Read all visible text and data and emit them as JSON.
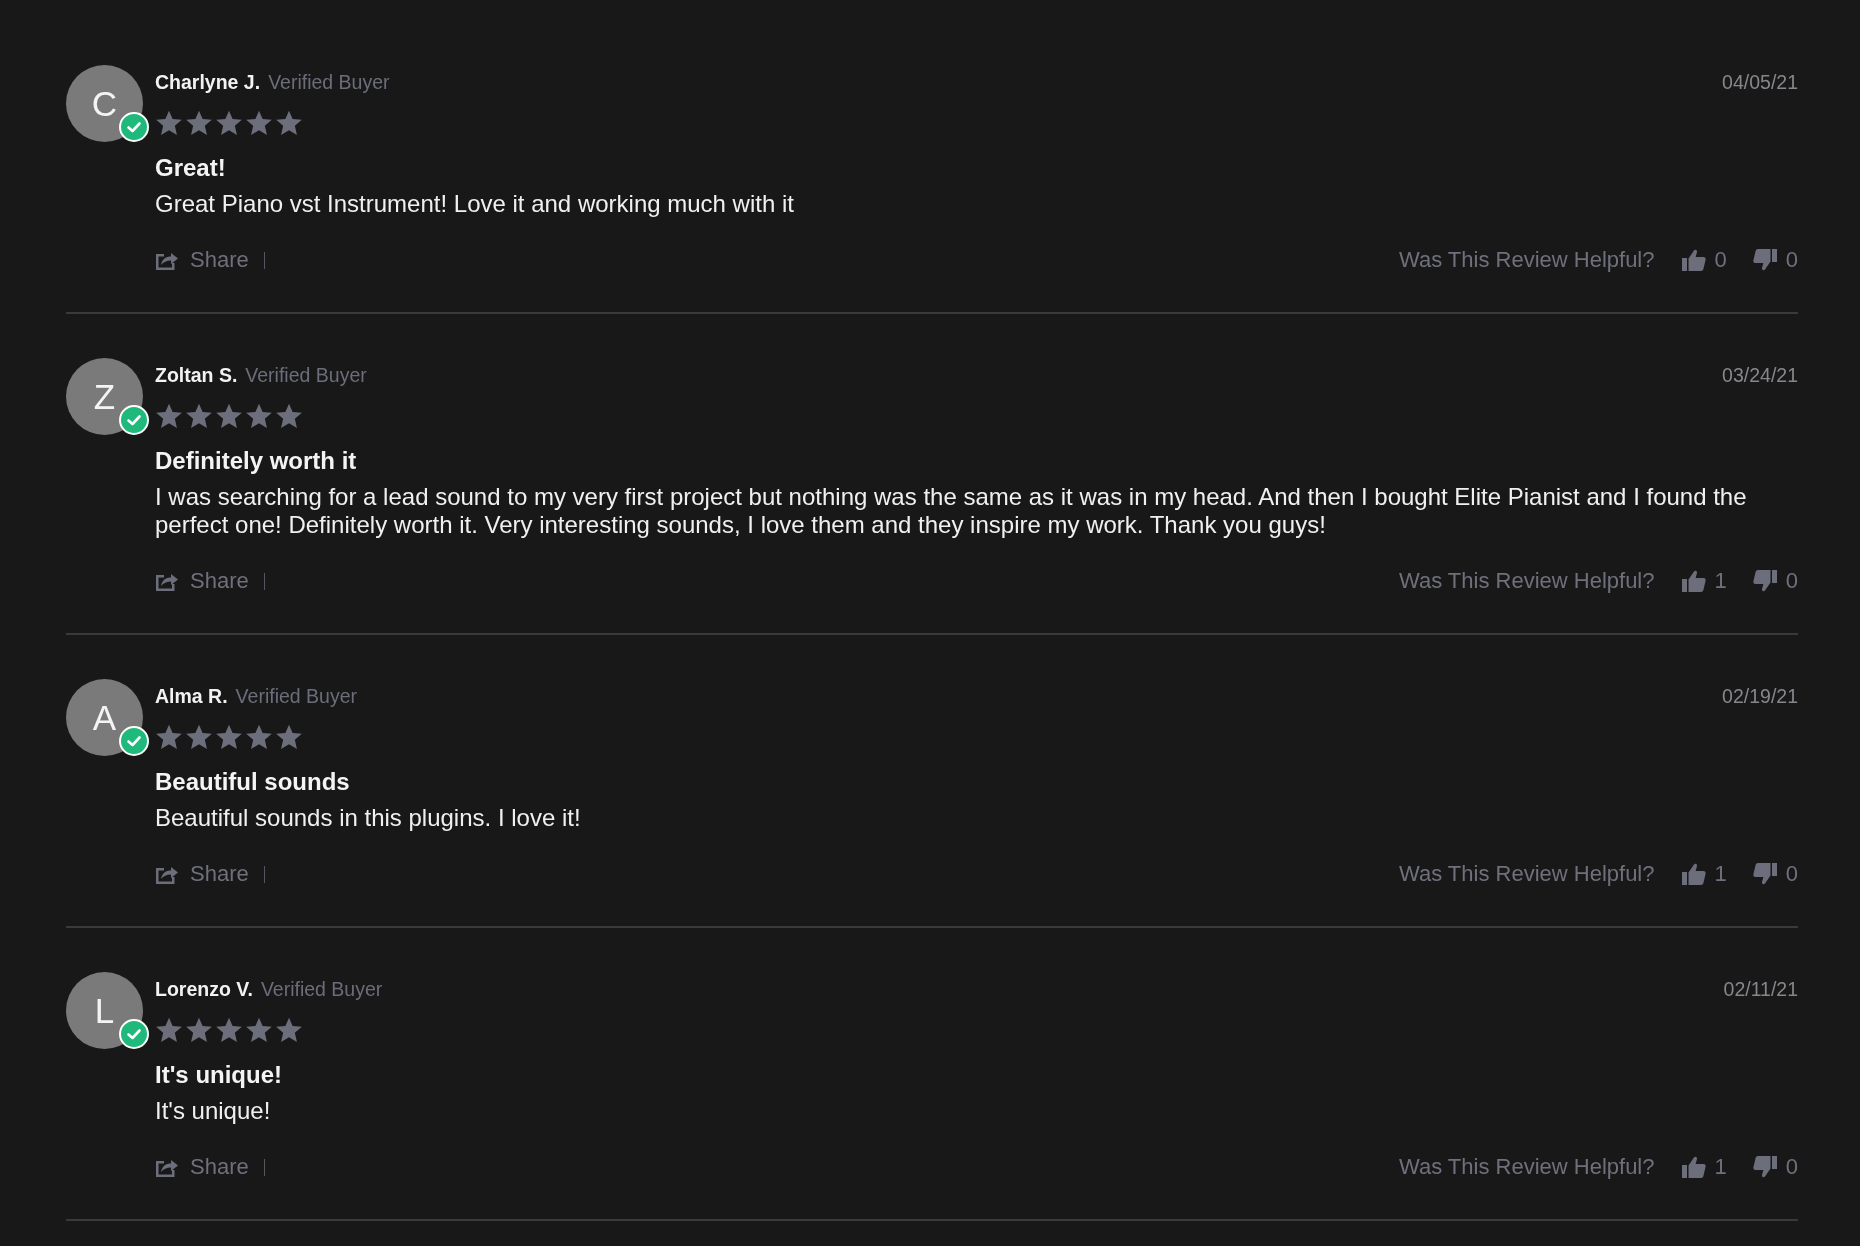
{
  "reviews": [
    {
      "initial": "C",
      "verified": true,
      "author": "Charlyne J.",
      "verified_label": "Verified Buyer",
      "date": "04/05/21",
      "stars": 5,
      "title": "Great!",
      "body": "Great Piano vst Instrument! Love it and working much with it",
      "share_label": "Share",
      "helpful_prompt": "Was This Review Helpful?",
      "up_count": "0",
      "down_count": "0"
    },
    {
      "initial": "Z",
      "verified": true,
      "author": "Zoltan S.",
      "verified_label": "Verified Buyer",
      "date": "03/24/21",
      "stars": 5,
      "title": "Definitely worth it",
      "body": "I was searching for a lead sound to my very first project but nothing was the same as it was in my head. And then I bought Elite Pianist and I found the perfect one! Definitely worth it. Very interesting sounds, I love them and they inspire my work. Thank you guys!",
      "share_label": "Share",
      "helpful_prompt": "Was This Review Helpful?",
      "up_count": "1",
      "down_count": "0"
    },
    {
      "initial": "A",
      "verified": true,
      "author": "Alma R.",
      "verified_label": "Verified Buyer",
      "date": "02/19/21",
      "stars": 5,
      "title": "Beautiful sounds",
      "body": "Beautiful sounds in this plugins. I love it!",
      "share_label": "Share",
      "helpful_prompt": "Was This Review Helpful?",
      "up_count": "1",
      "down_count": "0"
    },
    {
      "initial": "L",
      "verified": true,
      "author": "Lorenzo V.",
      "verified_label": "Verified Buyer",
      "date": "02/11/21",
      "stars": 5,
      "title": "It's unique!",
      "body": "It's unique!",
      "share_label": "Share",
      "helpful_prompt": "Was This Review Helpful?",
      "up_count": "1",
      "down_count": "0"
    }
  ]
}
